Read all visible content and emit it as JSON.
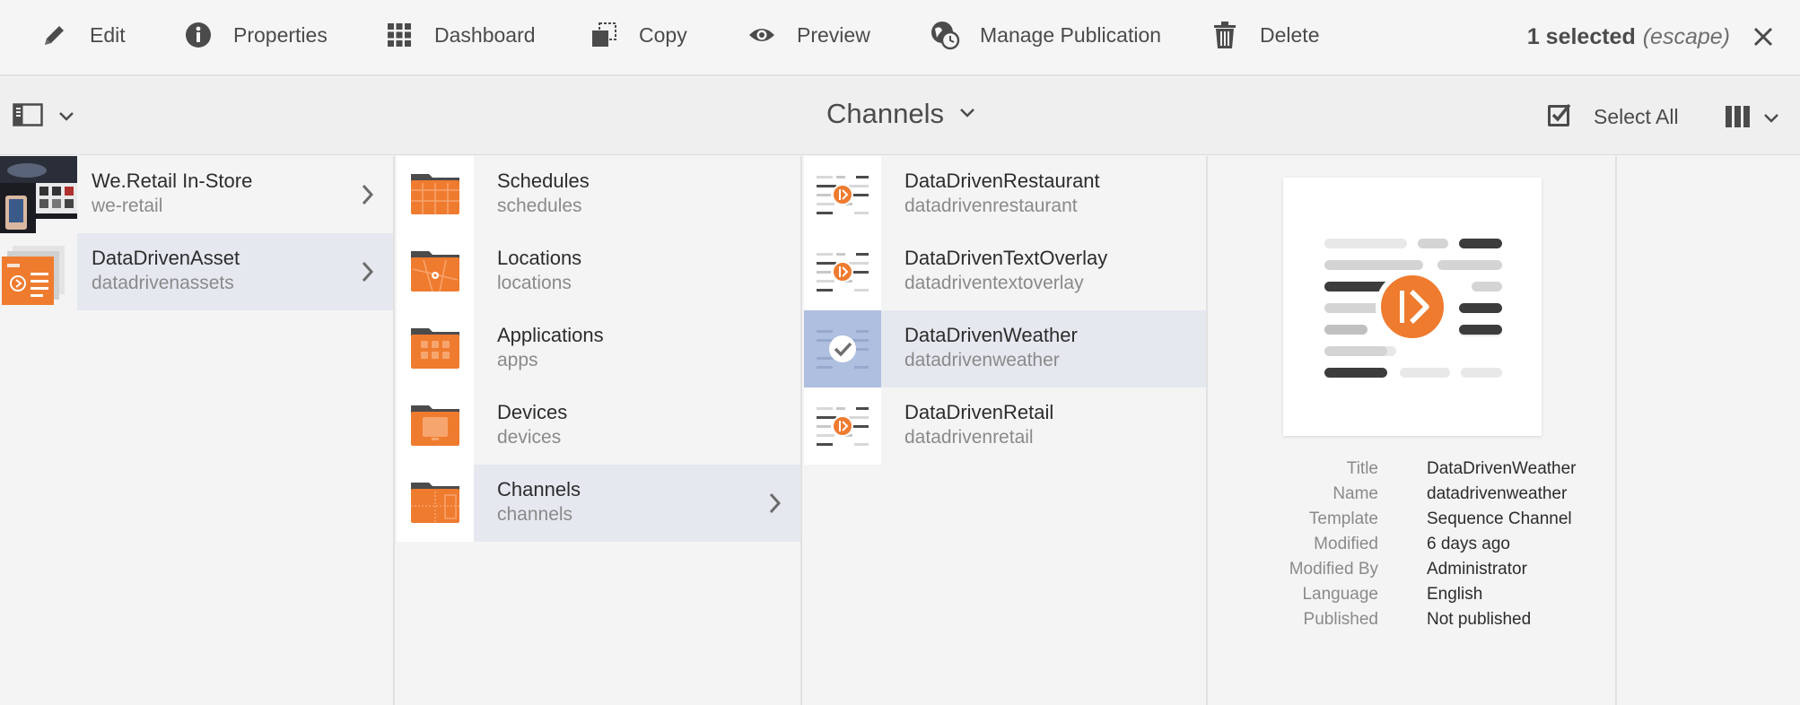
{
  "actions": {
    "edit": "Edit",
    "properties": "Properties",
    "dashboard": "Dashboard",
    "copy": "Copy",
    "preview": "Preview",
    "manage_publication": "Manage Publication",
    "delete": "Delete"
  },
  "selection": {
    "count": "1 selected",
    "escape": "(escape)"
  },
  "titlebar": {
    "title": "Channels",
    "select_all": "Select All"
  },
  "columns": {
    "sites": [
      {
        "title": "We.Retail In-Store",
        "name": "we-retail"
      },
      {
        "title": "DataDrivenAsset",
        "name": "datadrivenassets"
      }
    ],
    "folders": [
      {
        "title": "Schedules",
        "name": "schedules"
      },
      {
        "title": "Locations",
        "name": "locations"
      },
      {
        "title": "Applications",
        "name": "apps"
      },
      {
        "title": "Devices",
        "name": "devices"
      },
      {
        "title": "Channels",
        "name": "channels"
      }
    ],
    "channels": [
      {
        "title": "DataDrivenRestaurant",
        "name": "datadrivenrestaurant"
      },
      {
        "title": "DataDrivenTextOverlay",
        "name": "datadriventextoverlay"
      },
      {
        "title": "DataDrivenWeather",
        "name": "datadrivenweather"
      },
      {
        "title": "DataDrivenRetail",
        "name": "datadrivenretail"
      }
    ]
  },
  "details": {
    "labels": {
      "title": "Title",
      "name": "Name",
      "template": "Template",
      "modified": "Modified",
      "modified_by": "Modified By",
      "language": "Language",
      "published": "Published"
    },
    "values": {
      "title": "DataDrivenWeather",
      "name": "datadrivenweather",
      "template": "Sequence Channel",
      "modified": "6 days ago",
      "modified_by": "Administrator",
      "language": "English",
      "published": "Not published"
    }
  },
  "colors": {
    "accent_orange": "#ef7b2f",
    "selection_blue": "#aebfe0",
    "active_row": "#e5e8ef",
    "text_primary": "#2c2c2c",
    "text_secondary": "#8a8a8a"
  },
  "icons": {
    "edit": "pencil-icon",
    "properties": "info-icon",
    "dashboard": "grid-icon",
    "copy": "copy-icon",
    "preview": "eye-icon",
    "manage_publication": "globe-clock-icon",
    "delete": "trash-icon",
    "close": "close-icon"
  }
}
